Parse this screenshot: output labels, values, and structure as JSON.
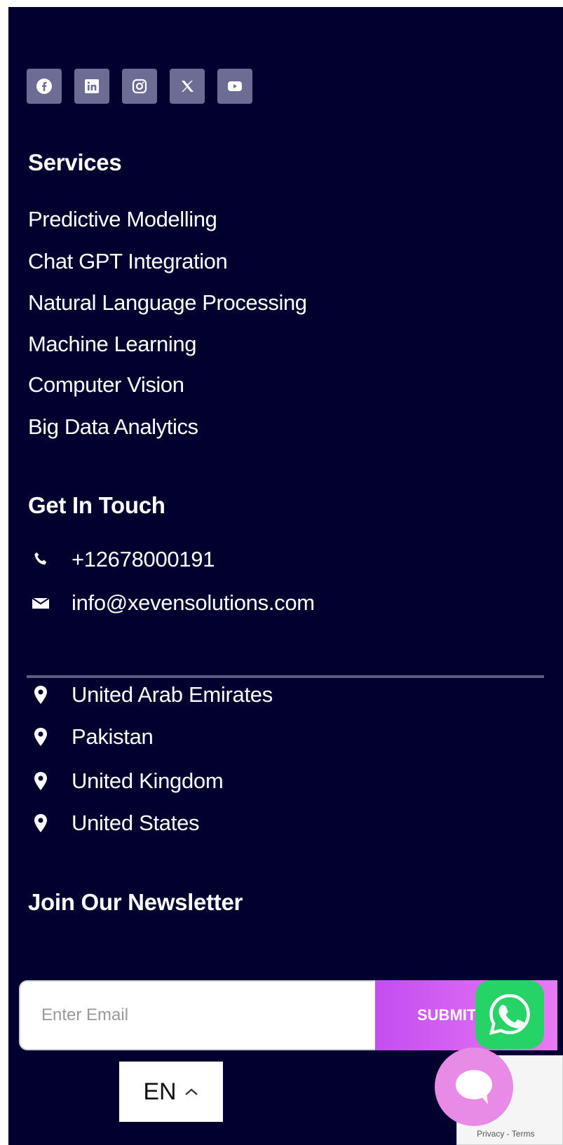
{
  "top_partial_text": "",
  "socials": [
    {
      "icon": "facebook-icon"
    },
    {
      "icon": "linkedin-icon"
    },
    {
      "icon": "instagram-icon"
    },
    {
      "icon": "x-icon"
    },
    {
      "icon": "youtube-icon"
    }
  ],
  "services": {
    "heading": "Services",
    "items": [
      "Predictive Modelling",
      "Chat GPT Integration",
      "Natural Language Processing",
      "Machine Learning",
      "Computer Vision",
      "Big Data Analytics"
    ]
  },
  "contact": {
    "heading": "Get In Touch",
    "phone": "+12678000191",
    "email": "info@xevensolutions.com"
  },
  "locations": [
    "United Arab Emirates",
    "Pakistan",
    "United Kingdom",
    "United States"
  ],
  "newsletter": {
    "heading": "Join Our Newsletter",
    "placeholder": "Enter Email",
    "submit_label": "SUBMIT"
  },
  "language": {
    "label": "EN"
  },
  "recaptcha": {
    "legal": "Privacy - Terms"
  },
  "colors": {
    "background": "#02002e",
    "social_bg": "#6c6c94",
    "submit_gradient_start": "#c44df0",
    "submit_gradient_end": "#e87af5",
    "whatsapp": "#26d366",
    "chat_bubble": "#e78be6"
  }
}
